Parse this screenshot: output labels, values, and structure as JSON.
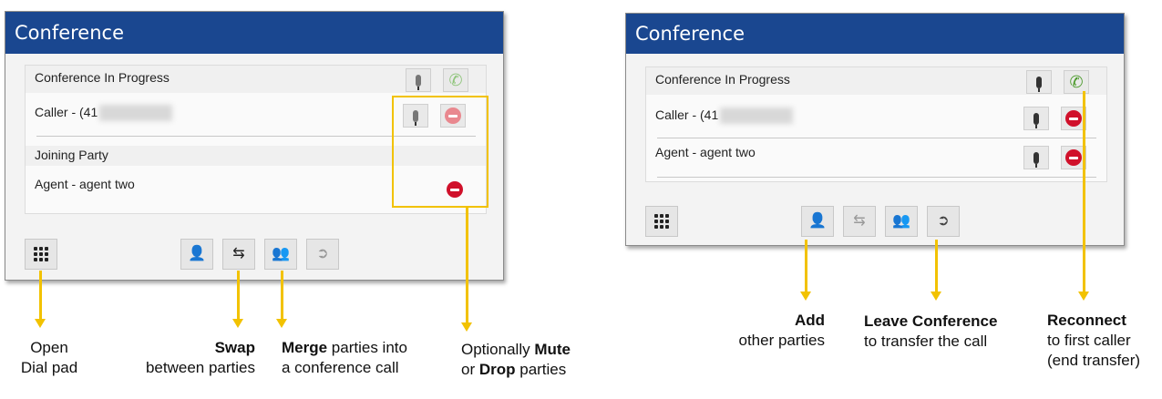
{
  "left_panel": {
    "title": "Conference",
    "status_heading": "Conference In Progress",
    "caller_label": "Caller - (41",
    "joining_heading": "Joining Party",
    "agent_label": "Agent - agent two"
  },
  "right_panel": {
    "title": "Conference",
    "status_heading": "Conference In Progress",
    "caller_label": "Caller - (41",
    "agent_label": "Agent - agent two"
  },
  "icons": {
    "dialpad": "dialpad-icon",
    "add_party": "add-party-icon",
    "swap": "swap-icon",
    "merge": "merge-icon",
    "leave": "leave-conference-icon",
    "mute": "microphone-icon",
    "drop": "drop-call-icon",
    "reconnect": "phone-icon"
  },
  "colors": {
    "title_bar": "#1a4790",
    "annotation": "#f2c200",
    "drop": "#d0102a",
    "reconnect": "#4a9a2a"
  },
  "captions": {
    "open_line1": "Open",
    "open_line2": "Dial pad",
    "swap_bold": "Swap",
    "swap_line2": "between parties",
    "merge_bold": "Merge",
    "merge_rest": " parties into",
    "merge_line2": "a conference call",
    "optional_prefix": "Optionally ",
    "optional_mute": "Mute",
    "optional_or": "or ",
    "optional_drop": "Drop",
    "optional_suffix": " parties",
    "add_bold": "Add",
    "add_line2": "other parties",
    "leave_bold": "Leave Conference",
    "leave_line2": "to transfer the call",
    "reconnect_bold": "Reconnect",
    "reconnect_line2": "to first caller",
    "reconnect_line3": "(end  transfer)"
  }
}
